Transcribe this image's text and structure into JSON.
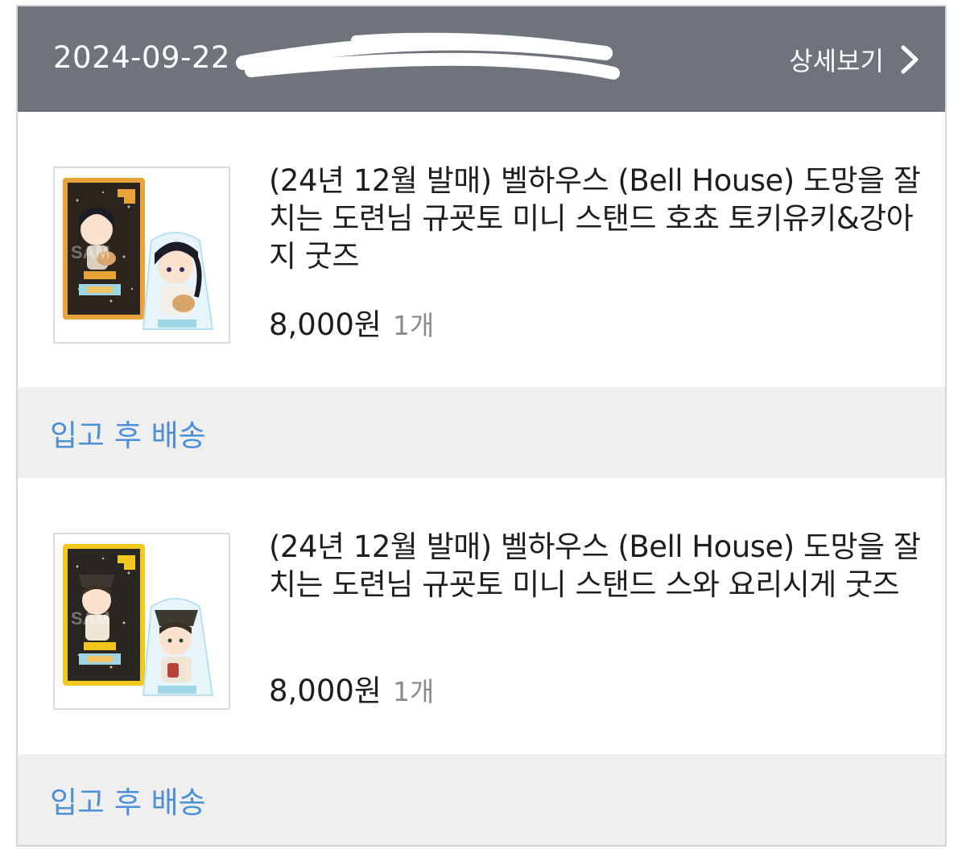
{
  "header": {
    "date": "2024-09-22",
    "detail_label": "상세보기",
    "detail_icon": "chevron-right-icon"
  },
  "orders": [
    {
      "title": "(24년 12월 발매) 벨하우스 (Bell House) 도망을 잘 치는 도련님 규굣토 미니 스탠드 호쵸 토키유키&강아지 굿즈",
      "price": "8,000원",
      "quantity": "1개",
      "status": "입고 후 배송",
      "thumbnail": "acrylic-stand-thumbnail"
    },
    {
      "title": "(24년 12월 발매) 벨하우스 (Bell House) 도망을 잘 치는 도련님 규굣토 미니 스탠드 스와 요리시게 굿즈",
      "price": "8,000원",
      "quantity": "1개",
      "status": "입고 후 배송",
      "thumbnail": "acrylic-stand-thumbnail"
    }
  ],
  "colors": {
    "header_bg": "#6f737b",
    "status_bg": "#efeff0",
    "status_text": "#4a8fd8"
  }
}
